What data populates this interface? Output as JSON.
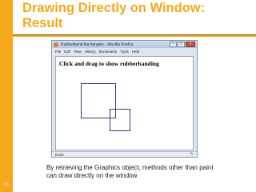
{
  "slide": {
    "title_lines": [
      "Drawing Directly on Window:",
      "Result"
    ],
    "caption_lines": [
      "By retrieving the Graphics object, methods other than paint",
      "can draw directly on the window"
    ],
    "slide_number": "16",
    "accent_color": "#f4a81a"
  },
  "window": {
    "title": "Rubberband Rectangles - Mozilla Firefox",
    "app_icon": "firefox-icon",
    "menu": [
      "File",
      "Edit",
      "View",
      "History",
      "Bookmarks",
      "Tools",
      "Help"
    ],
    "controls": [
      "minimize",
      "maximize",
      "close"
    ],
    "content_heading": "Click and drag to show rubberbanding",
    "status_text": "Done",
    "status_icon": "addon-icon"
  }
}
